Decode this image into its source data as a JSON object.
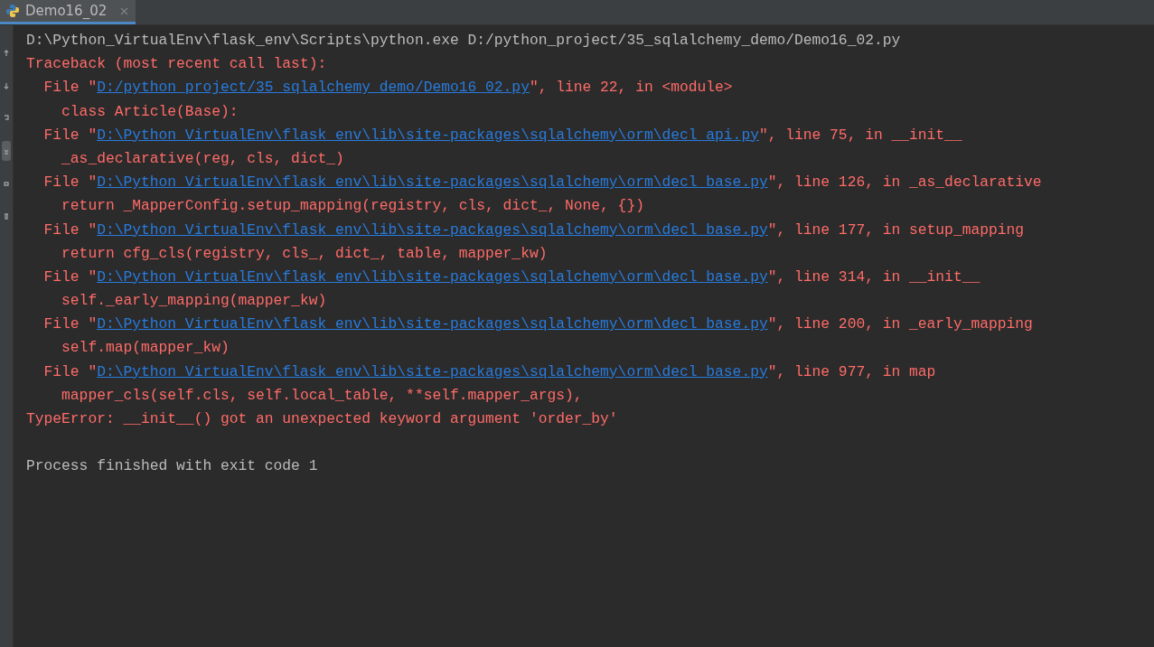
{
  "tabs": [
    {
      "label": "Demo16_02",
      "selected": true
    }
  ],
  "console": {
    "lines": [
      {
        "kind": "plain",
        "text": "D:\\Python_VirtualEnv\\flask_env\\Scripts\\python.exe D:/python_project/35_sqlalchemy_demo/Demo16_02.py"
      },
      {
        "kind": "error",
        "text": "Traceback (most recent call last):"
      },
      {
        "kind": "file",
        "prefix": "File \"",
        "link": "D:/python_project/35_sqlalchemy_demo/Demo16_02.py",
        "suffix": "\", line 22, in <module>"
      },
      {
        "kind": "code",
        "text": "class Article(Base):"
      },
      {
        "kind": "file",
        "prefix": "File \"",
        "link": "D:\\Python_VirtualEnv\\flask_env\\lib\\site-packages\\sqlalchemy\\orm\\decl_api.py",
        "suffix": "\", line 75, in __init__"
      },
      {
        "kind": "code",
        "text": "_as_declarative(reg, cls, dict_)"
      },
      {
        "kind": "file",
        "prefix": "File \"",
        "link": "D:\\Python_VirtualEnv\\flask_env\\lib\\site-packages\\sqlalchemy\\orm\\decl_base.py",
        "suffix": "\", line 126, in _as_declarative"
      },
      {
        "kind": "code",
        "text": "return _MapperConfig.setup_mapping(registry, cls, dict_, None, {})"
      },
      {
        "kind": "file",
        "prefix": "File \"",
        "link": "D:\\Python_VirtualEnv\\flask_env\\lib\\site-packages\\sqlalchemy\\orm\\decl_base.py",
        "suffix": "\", line 177, in setup_mapping"
      },
      {
        "kind": "code",
        "text": "return cfg_cls(registry, cls_, dict_, table, mapper_kw)"
      },
      {
        "kind": "file",
        "prefix": "File \"",
        "link": "D:\\Python_VirtualEnv\\flask_env\\lib\\site-packages\\sqlalchemy\\orm\\decl_base.py",
        "suffix": "\", line 314, in __init__"
      },
      {
        "kind": "code",
        "text": "self._early_mapping(mapper_kw)"
      },
      {
        "kind": "file",
        "prefix": "File \"",
        "link": "D:\\Python_VirtualEnv\\flask_env\\lib\\site-packages\\sqlalchemy\\orm\\decl_base.py",
        "suffix": "\", line 200, in _early_mapping"
      },
      {
        "kind": "code",
        "text": "self.map(mapper_kw)"
      },
      {
        "kind": "file",
        "prefix": "File \"",
        "link": "D:\\Python_VirtualEnv\\flask_env\\lib\\site-packages\\sqlalchemy\\orm\\decl_base.py",
        "suffix": "\", line 977, in map"
      },
      {
        "kind": "code",
        "text": "mapper_cls(self.cls, self.local_table, **self.mapper_args),"
      },
      {
        "kind": "error",
        "text": "TypeError: __init__() got an unexpected keyword argument 'order_by'"
      },
      {
        "kind": "blank"
      },
      {
        "kind": "plain",
        "text": "Process finished with exit code 1"
      }
    ]
  }
}
